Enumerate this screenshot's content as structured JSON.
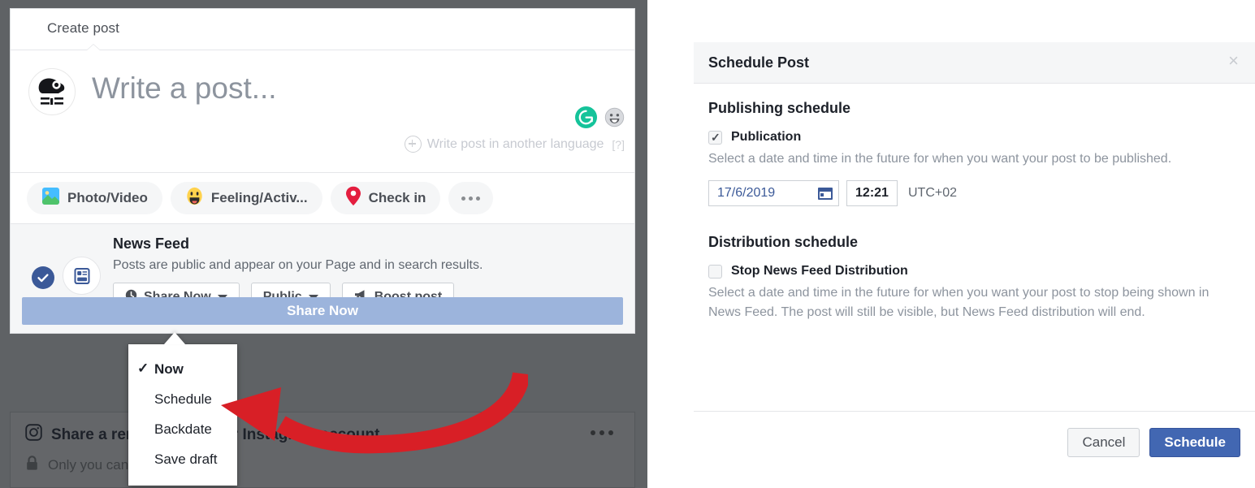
{
  "composer": {
    "tab_label": "Create post",
    "avatar_alt": "cat-avatar",
    "write_placeholder": "Write a post...",
    "another_language_label": "Write post in another language",
    "help_label": "[?]",
    "actions": [
      {
        "label": "Photo/Video",
        "icon": "photo-video-icon"
      },
      {
        "label": "Feeling/Activ...",
        "icon": "feeling-activity-icon"
      },
      {
        "label": "Check in",
        "icon": "location-pin-icon"
      }
    ],
    "more_actions_label": "",
    "news_feed": {
      "title": "News Feed",
      "description": "Posts are public and appear on your Page and in search results.",
      "share_now_label": "Share Now",
      "audience_label": "Public",
      "boost_label": "Boost post",
      "submit_label": "Share Now"
    },
    "dropdown": {
      "items": [
        {
          "label": "Now",
          "selected": true
        },
        {
          "label": "Schedule",
          "selected": false
        },
        {
          "label": "Backdate",
          "selected": false
        },
        {
          "label": "Save draft",
          "selected": false
        }
      ],
      "check_glyph": "✓"
    },
    "instagram_card": {
      "headline": "Share a reminder on your Instagram account",
      "subtext": "Only you can see this",
      "privacy_icon": "lock-icon",
      "brand_icon": "instagram-icon"
    }
  },
  "dialog": {
    "title": "Schedule Post",
    "close_label": "×",
    "publishing": {
      "heading": "Publishing schedule",
      "checkbox_label": "Publication",
      "checked": true,
      "description": "Select a date and time in the future for when you want your post to be published.",
      "date_value": "17/6/2019",
      "time_value": "12:21",
      "timezone": "UTC+02"
    },
    "distribution": {
      "heading": "Distribution schedule",
      "checkbox_label": "Stop News Feed Distribution",
      "checked": false,
      "description": "Select a date and time in the future for when you want your post to stop being shown in News Feed. The post will still be visible, but News Feed distribution will end."
    },
    "footer": {
      "cancel_label": "Cancel",
      "schedule_label": "Schedule"
    }
  },
  "colors": {
    "fb_blue": "#4267b2",
    "muted_blue": "#9cb4dc",
    "panel_gray": "#5f6265",
    "arrow_red": "#d81f26",
    "link_blue": "#3b5998",
    "grammarly_green": "#15c39a"
  },
  "annotation": {
    "arrow_name": "red-curved-arrow-to-schedule"
  }
}
